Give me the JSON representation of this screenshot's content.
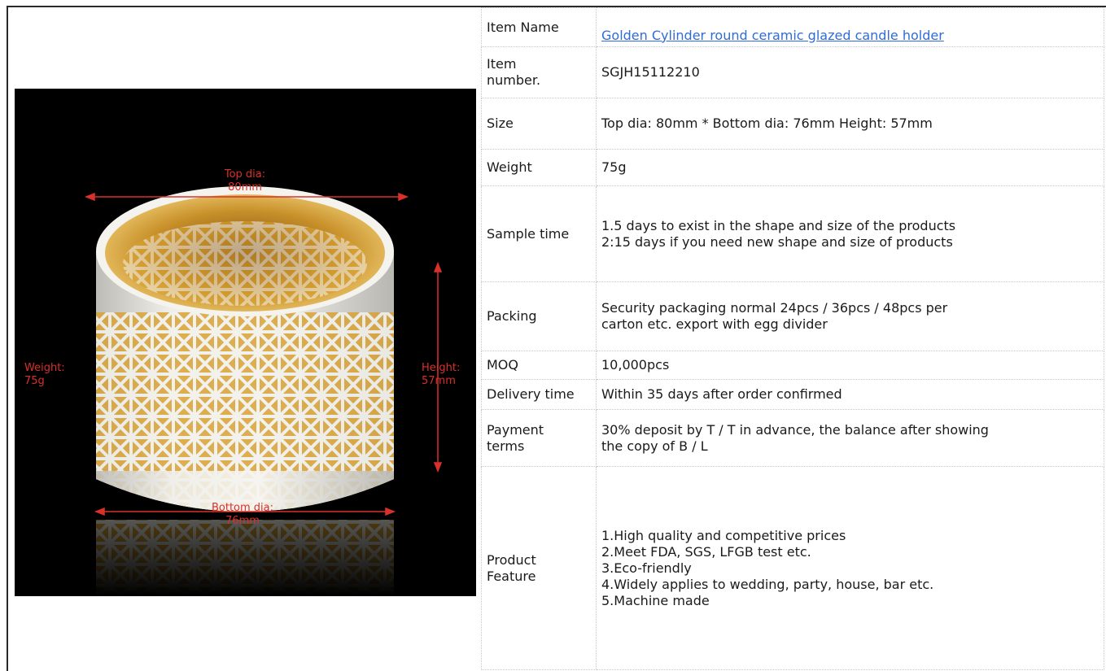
{
  "product_image": {
    "annotations": {
      "top_dia": "Top dia:\n80mm",
      "weight": "Weight:\n75g",
      "height": "Height:\n57mm",
      "bottom_dia": "Bottom dia:\n76mm"
    }
  },
  "specs": [
    {
      "label": "Item Name",
      "value": "Golden Cylinder round ceramic glazed candle holder",
      "is_link": true
    },
    {
      "label": "Item\nnumber.",
      "value": "SGJH15112210"
    },
    {
      "label": "Size",
      "value": "Top dia: 80mm * Bottom dia: 76mm Height: 57mm"
    },
    {
      "label": "Weight",
      "value": "75g"
    },
    {
      "label": "Sample time",
      "value": "1.5 days to exist in the shape and size of the products\n2:15 days if you need new shape and size of products"
    },
    {
      "label": "Packing",
      "value": "Security packaging normal 24pcs / 36pcs / 48pcs per\ncarton etc. export with egg divider"
    },
    {
      "label": "MOQ",
      "value": "10,000pcs"
    },
    {
      "label": "Delivery time",
      "value": "Within 35 days after order confirmed"
    },
    {
      "label": "Payment\nterms",
      "value": "30% deposit by T / T in advance, the balance after showing\nthe copy of B / L"
    },
    {
      "label": "Product\nFeature",
      "value": "1.High quality and competitive prices\n2.Meet FDA, SGS, LFGB test etc.\n3.Eco-friendly\n4.Widely applies to wedding, party, house, bar etc.\n5.Machine made"
    }
  ],
  "colors": {
    "link": "#2f6cd8",
    "annotation": "#d9302a",
    "gold": "#c8902a",
    "ceramic": "#ecebe6"
  }
}
